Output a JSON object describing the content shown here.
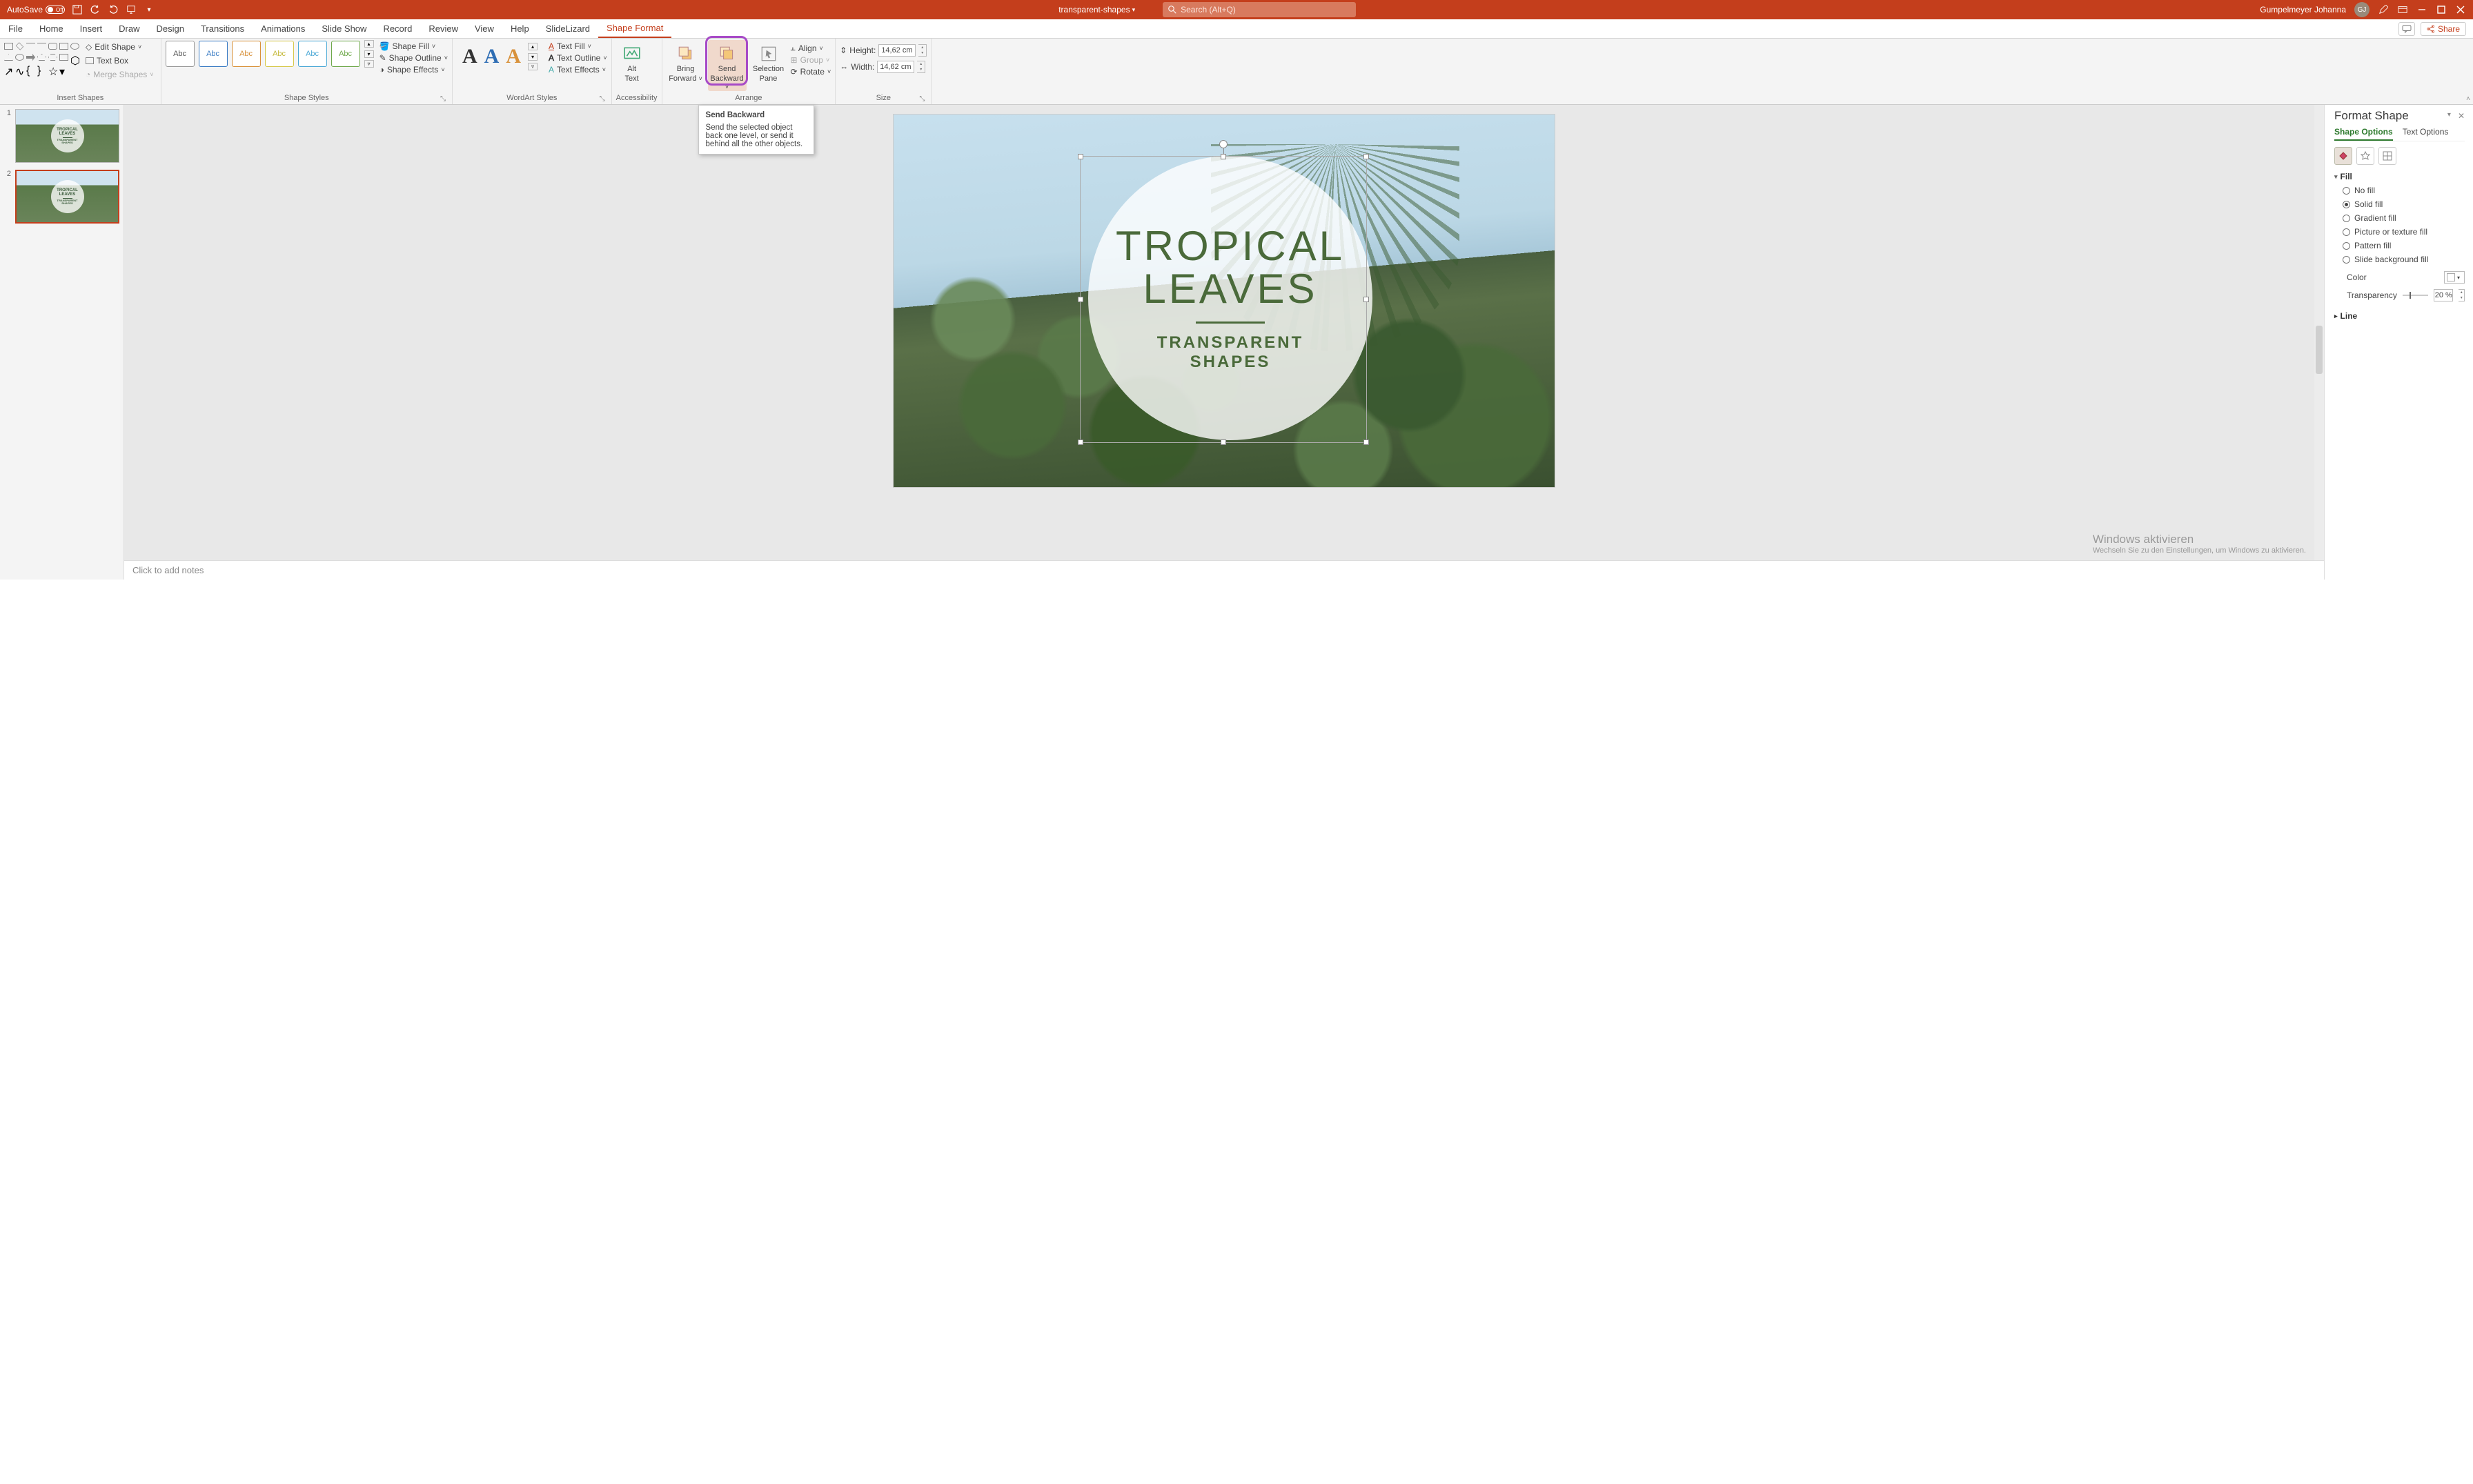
{
  "titlebar": {
    "autosave_label": "AutoSave",
    "autosave_state": "Off",
    "doc_name": "transparent-shapes",
    "search_placeholder": "Search (Alt+Q)",
    "user_name": "Gumpelmeyer Johanna",
    "user_initials": "GJ"
  },
  "tabs": {
    "file": "File",
    "home": "Home",
    "insert": "Insert",
    "draw": "Draw",
    "design": "Design",
    "transitions": "Transitions",
    "animations": "Animations",
    "slideshow": "Slide Show",
    "record": "Record",
    "review": "Review",
    "view": "View",
    "help": "Help",
    "slidelizard": "SlideLizard",
    "shapeformat": "Shape Format",
    "share": "Share"
  },
  "ribbon": {
    "insert_shapes": {
      "edit_shape": "Edit Shape",
      "text_box": "Text Box",
      "merge_shapes": "Merge Shapes",
      "group_label": "Insert Shapes"
    },
    "shape_styles": {
      "swatch_label": "Abc",
      "shape_fill": "Shape Fill",
      "shape_outline": "Shape Outline",
      "shape_effects": "Shape Effects",
      "group_label": "Shape Styles"
    },
    "wordart_styles": {
      "letter": "A",
      "text_fill": "Text Fill",
      "text_outline": "Text Outline",
      "text_effects": "Text Effects",
      "group_label": "WordArt Styles"
    },
    "accessibility": {
      "alt_text_l1": "Alt",
      "alt_text_l2": "Text",
      "group_label": "Accessibility"
    },
    "arrange": {
      "bring_forward_l1": "Bring",
      "bring_forward_l2": "Forward",
      "send_backward_l1": "Send",
      "send_backward_l2": "Backward",
      "selection_pane_l1": "Selection",
      "selection_pane_l2": "Pane",
      "align": "Align",
      "group": "Group",
      "rotate": "Rotate",
      "group_label": "Arrange"
    },
    "size": {
      "height_label": "Height:",
      "height_value": "14,62 cm",
      "width_label": "Width:",
      "width_value": "14,62 cm",
      "group_label": "Size"
    }
  },
  "tooltip": {
    "title": "Send Backward",
    "body": "Send the selected object back one level, or send it behind all the other objects."
  },
  "thumbnails": {
    "slide1_num": "1",
    "slide2_num": "2",
    "thumb_title_l1": "TROPICAL",
    "thumb_title_l2": "LEAVES",
    "thumb_sub_l1": "TRANSPARENT",
    "thumb_sub_l2": "SHAPES"
  },
  "slide": {
    "title_l1": "TROPICAL",
    "title_l2": "LEAVES",
    "subtitle_l1": "TRANSPARENT",
    "subtitle_l2": "SHAPES"
  },
  "format_pane": {
    "title": "Format Shape",
    "tab_shape": "Shape Options",
    "tab_text": "Text Options",
    "section_fill": "Fill",
    "opt_no_fill": "No fill",
    "opt_solid_fill": "Solid fill",
    "opt_gradient_fill": "Gradient fill",
    "opt_picture_fill": "Picture or texture fill",
    "opt_pattern_fill": "Pattern fill",
    "opt_slide_bg_fill": "Slide background fill",
    "color_label": "Color",
    "transparency_label": "Transparency",
    "transparency_value": "20 %",
    "section_line": "Line"
  },
  "notes": {
    "placeholder": "Click to add notes"
  },
  "activation": {
    "line1": "Windows aktivieren",
    "line2": "Wechseln Sie zu den Einstellungen, um Windows zu aktivieren."
  }
}
